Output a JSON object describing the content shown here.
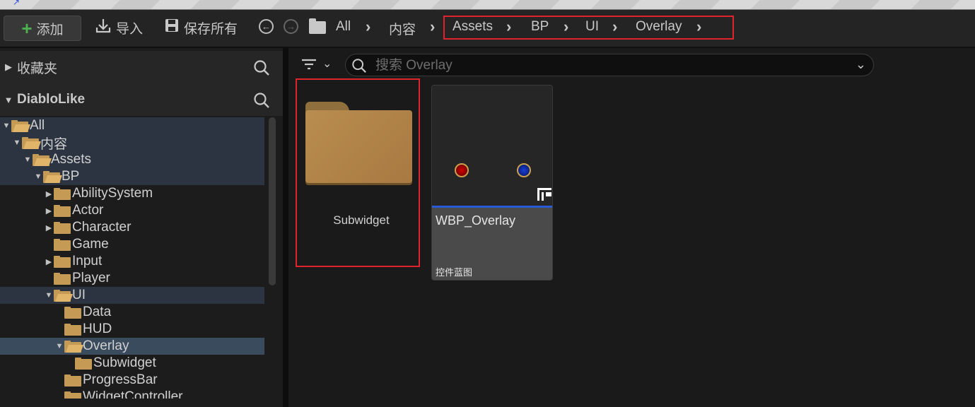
{
  "toolbar": {
    "add_label": "添加",
    "import_label": "导入",
    "save_all_label": "保存所有"
  },
  "breadcrumb": [
    "All",
    "内容",
    "Assets",
    "BP",
    "UI",
    "Overlay"
  ],
  "sidebar": {
    "favorites_label": "收藏夹",
    "project_label": "DiabloLike",
    "tree": [
      {
        "label": "All",
        "depth": 0,
        "arrow": "down",
        "open": true,
        "state": "path"
      },
      {
        "label": "内容",
        "depth": 1,
        "arrow": "down",
        "open": true,
        "state": "path"
      },
      {
        "label": "Assets",
        "depth": 2,
        "arrow": "down",
        "open": true,
        "state": "path"
      },
      {
        "label": "BP",
        "depth": 3,
        "arrow": "down",
        "open": true,
        "state": "path"
      },
      {
        "label": "AbilitySystem",
        "depth": 4,
        "arrow": "right",
        "open": false,
        "state": ""
      },
      {
        "label": "Actor",
        "depth": 4,
        "arrow": "right",
        "open": false,
        "state": ""
      },
      {
        "label": "Character",
        "depth": 4,
        "arrow": "right",
        "open": false,
        "state": ""
      },
      {
        "label": "Game",
        "depth": 4,
        "arrow": "",
        "open": false,
        "state": ""
      },
      {
        "label": "Input",
        "depth": 4,
        "arrow": "right",
        "open": false,
        "state": ""
      },
      {
        "label": "Player",
        "depth": 4,
        "arrow": "",
        "open": false,
        "state": ""
      },
      {
        "label": "UI",
        "depth": 4,
        "arrow": "down",
        "open": true,
        "state": "path"
      },
      {
        "label": "Data",
        "depth": 5,
        "arrow": "",
        "open": false,
        "state": ""
      },
      {
        "label": "HUD",
        "depth": 5,
        "arrow": "",
        "open": false,
        "state": ""
      },
      {
        "label": "Overlay",
        "depth": 5,
        "arrow": "down",
        "open": true,
        "state": "sel"
      },
      {
        "label": "Subwidget",
        "depth": 6,
        "arrow": "",
        "open": false,
        "state": ""
      },
      {
        "label": "ProgressBar",
        "depth": 5,
        "arrow": "",
        "open": false,
        "state": ""
      },
      {
        "label": "WidgetController",
        "depth": 5,
        "arrow": "",
        "open": false,
        "state": ""
      }
    ]
  },
  "search": {
    "placeholder": "搜索 Overlay"
  },
  "assets": {
    "folder_label": "Subwidget",
    "blueprint_name": "WBP_Overlay",
    "blueprint_type": "控件蓝图"
  },
  "colors": {
    "folder": "#c59a54",
    "highlight_border": "#e0242e",
    "selection": "#3b4b5e",
    "blueprint_bar": "#2a5bd7"
  }
}
